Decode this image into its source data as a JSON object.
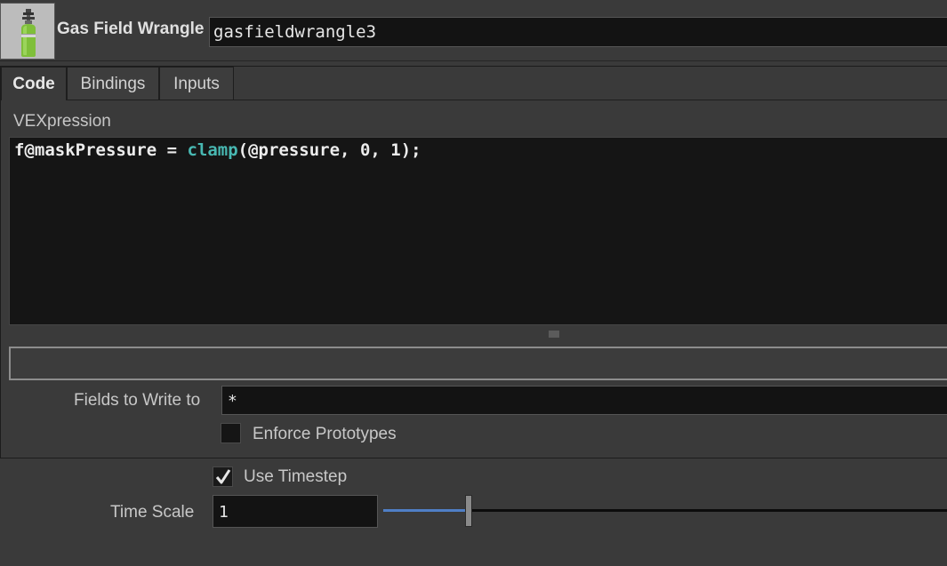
{
  "header": {
    "node_type": "Gas Field Wrangle",
    "node_name": "gasfieldwrangle3",
    "icon": "gas-cylinder-icon"
  },
  "tabs": [
    {
      "label": "Code",
      "active": true
    },
    {
      "label": "Bindings",
      "active": false
    },
    {
      "label": "Inputs",
      "active": false
    }
  ],
  "code_tab": {
    "vex_label": "VEXpression",
    "code": {
      "part1": "f@maskPressure = ",
      "function": "clamp",
      "part2": "(@pressure, 0, 1);"
    },
    "fields_label": "Fields to Write to",
    "fields_value": "*",
    "enforce_prototypes_label": "Enforce Prototypes",
    "enforce_prototypes_checked": false
  },
  "timestep": {
    "use_timestep_label": "Use Timestep",
    "use_timestep_checked": true,
    "time_scale_label": "Time Scale",
    "time_scale_value": "1",
    "slider_accent": "#4f7fc6"
  },
  "colors": {
    "background": "#3a3a3a",
    "field_background": "#131313",
    "function_highlight": "#48b8b2"
  }
}
